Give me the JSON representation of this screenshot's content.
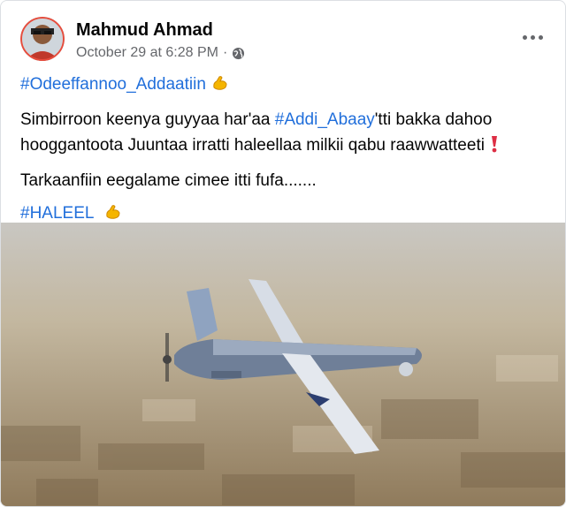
{
  "post": {
    "author": "Mahmud Ahmad",
    "timestamp": "October 29 at 6:28 PM",
    "separator": "·",
    "privacy_icon": "globe-icon",
    "more_icon": "more-options-icon",
    "hashtag_top": "#Odeeffannoo_Addaatiin",
    "line1_pre": "Simbirroon keenya guyyaa har'aa ",
    "line1_tag": "#Addi_Abaay",
    "line1_post": "'tti bakka dahoo",
    "line2": "hooggantoota Juuntaa irratti haleellaa milkii qabu raawwatteeti",
    "line3": "Tarkaanfiin eegalame cimee itti fufa.......",
    "hashtag_bottom": "#HALEEL",
    "emoji_muscle": "flexed-biceps-icon",
    "emoji_exclaim": "red-exclamation-icon",
    "photo": "drone-aerial-photo",
    "colors": {
      "link": "#216fdb",
      "meta": "#65676b",
      "text": "#050505"
    }
  }
}
